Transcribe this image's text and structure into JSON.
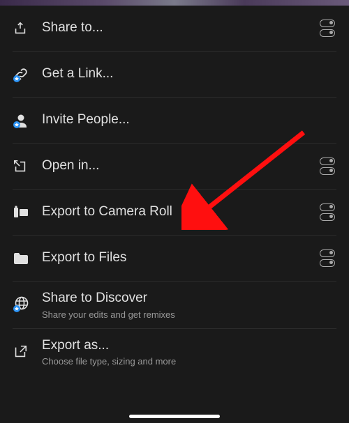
{
  "menu": [
    {
      "key": "share-to",
      "label": "Share to...",
      "icon": "share-icon",
      "toggle": true,
      "sub": null
    },
    {
      "key": "get-link",
      "label": "Get a Link...",
      "icon": "link-icon",
      "toggle": false,
      "sub": null
    },
    {
      "key": "invite-people",
      "label": "Invite People...",
      "icon": "invite-icon",
      "toggle": false,
      "sub": null
    },
    {
      "key": "open-in",
      "label": "Open in...",
      "icon": "open-in-icon",
      "toggle": true,
      "sub": null
    },
    {
      "key": "export-camera-roll",
      "label": "Export to Camera Roll",
      "icon": "camera-roll-icon",
      "toggle": true,
      "sub": null
    },
    {
      "key": "export-files",
      "label": "Export to Files",
      "icon": "folder-icon",
      "toggle": true,
      "sub": null
    },
    {
      "key": "share-discover",
      "label": "Share to Discover",
      "icon": "globe-icon",
      "toggle": false,
      "sub": "Share your edits and get remixes"
    },
    {
      "key": "export-as",
      "label": "Export as...",
      "icon": "export-as-icon",
      "toggle": false,
      "sub": "Choose file type, sizing and more"
    }
  ],
  "annotation": {
    "arrow_color": "#ff0f0f"
  }
}
